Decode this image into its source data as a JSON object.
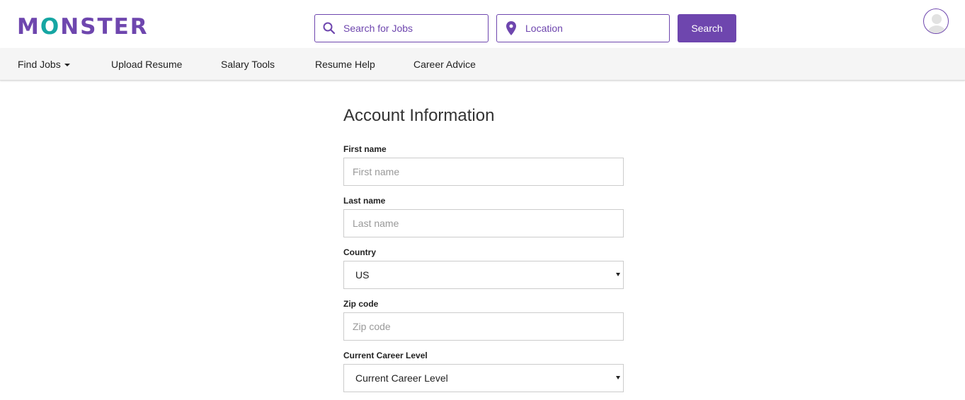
{
  "brand": {
    "logo_text_m": "M",
    "logo_text_o": "O",
    "logo_text_rest": "NSTER",
    "primary_color": "#6e46ae",
    "accent_color": "#16a6a3"
  },
  "header": {
    "search_jobs": {
      "placeholder": "Search for Jobs",
      "icon": "search-icon"
    },
    "location": {
      "placeholder": "Location",
      "icon": "map-pin-icon"
    },
    "search_button": "Search",
    "avatar_icon": "user-avatar-icon"
  },
  "nav": {
    "items": [
      {
        "label": "Find Jobs",
        "has_dropdown": true
      },
      {
        "label": "Upload Resume"
      },
      {
        "label": "Salary Tools"
      },
      {
        "label": "Resume Help"
      },
      {
        "label": "Career Advice"
      }
    ]
  },
  "form": {
    "title": "Account Information",
    "first_name": {
      "label": "First name",
      "placeholder": "First name"
    },
    "last_name": {
      "label": "Last name",
      "placeholder": "Last name"
    },
    "country": {
      "label": "Country",
      "selected": "US"
    },
    "zip": {
      "label": "Zip code",
      "placeholder": "Zip code"
    },
    "career_level": {
      "label": "Current Career Level",
      "selected": "Current Career Level"
    }
  }
}
